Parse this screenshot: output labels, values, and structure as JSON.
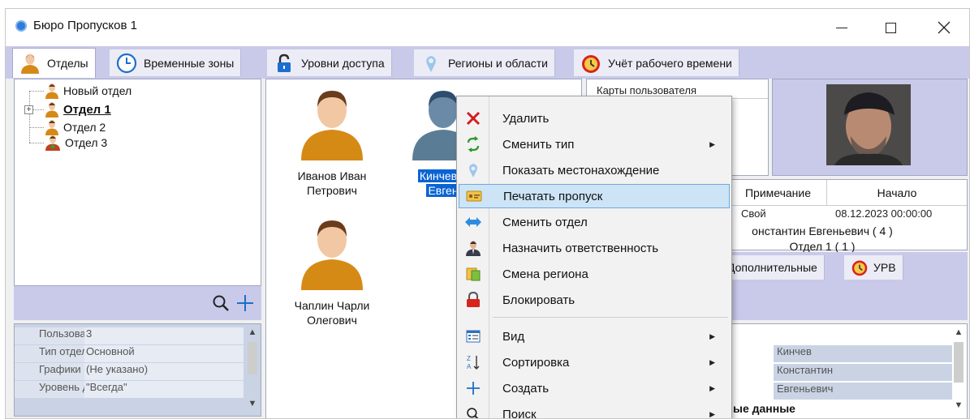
{
  "window": {
    "title": "Бюро Пропусков 1"
  },
  "tabs": [
    {
      "label": "Отделы",
      "icon": "person-icon"
    },
    {
      "label": "Временные зоны",
      "icon": "clock-icon"
    },
    {
      "label": "Уровни доступа",
      "icon": "lock-icon"
    },
    {
      "label": "Регионы и области",
      "icon": "map-pin-icon"
    },
    {
      "label": "Учёт рабочего времени",
      "icon": "alarm-clock-icon"
    }
  ],
  "tree": [
    {
      "label": "Новый отдел"
    },
    {
      "label": "Отдел 1"
    },
    {
      "label": "Отдел 2"
    },
    {
      "label": "Отдел 3"
    }
  ],
  "properties": [
    {
      "key": "Пользоват",
      "value": "3"
    },
    {
      "key": "Тип отдела",
      "value": "Основной"
    },
    {
      "key": "Графики ра",
      "value": "(Не указано)"
    },
    {
      "key": "Уровень дс",
      "value": "\"Всегда\""
    }
  ],
  "employees": [
    {
      "line1": "Иванов Иван",
      "line2": "Петрович"
    },
    {
      "line1": "Кинчев К",
      "line2": "Евген"
    },
    {
      "line1": "Чаплин Чарли",
      "line2": "Олегович"
    }
  ],
  "cards": {
    "header": "Карты пользователя"
  },
  "grid": {
    "col_note": "Примечание",
    "col_start": "Начало",
    "cell_note": "Свой",
    "cell_start": "08.12.2023 00:00:00"
  },
  "employee_info": {
    "name": "онстантин Евгеньевич ( 4 )",
    "dept": "Отдел 1 ( 1 )"
  },
  "subtabs": {
    "extra": "Дополнительные",
    "urv": "УРВ"
  },
  "detail": {
    "rows": [
      "Кинчев",
      "Константин",
      "Евгеньевич"
    ],
    "footer": "ые данные"
  },
  "context_menu": [
    {
      "label": "Удалить",
      "icon": "delete-x-icon"
    },
    {
      "label": "Сменить тип",
      "icon": "swap-arrows-icon",
      "submenu": true
    },
    {
      "label": "Показать местонахождение",
      "icon": "location-icon"
    },
    {
      "label": "Печатать пропуск",
      "icon": "print-pass-icon",
      "highlighted": true
    },
    {
      "label": "Сменить отдел",
      "icon": "move-arrows-icon"
    },
    {
      "label": "Назначить ответственность",
      "icon": "manager-icon"
    },
    {
      "label": "Смена региона",
      "icon": "region-icon"
    },
    {
      "label": "Блокировать",
      "icon": "padlock-icon"
    },
    {
      "label": "Вид",
      "icon": "view-icon",
      "submenu": true
    },
    {
      "label": "Сортировка",
      "icon": "sort-az-icon",
      "submenu": true
    },
    {
      "label": "Создать",
      "icon": "plus-icon",
      "submenu": true
    },
    {
      "label": "Поиск",
      "icon": "search-icon",
      "submenu": true
    }
  ]
}
